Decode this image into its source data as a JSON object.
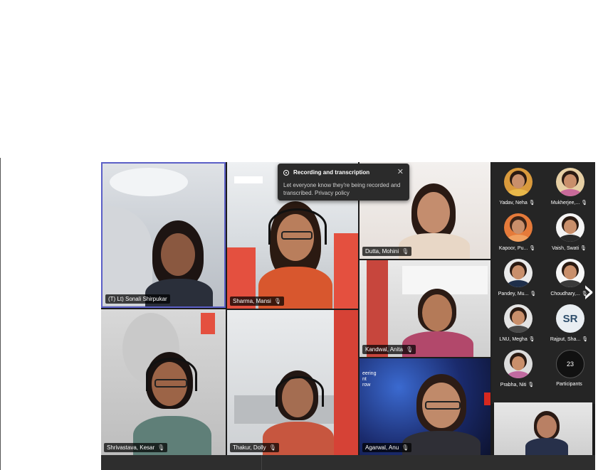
{
  "toast": {
    "title": "Recording and transcription",
    "body": "Let everyone know they're being recorded and transcribed. Privacy policy",
    "close_icon": "close-icon"
  },
  "grid": [
    {
      "name": "(T) Lt) Sonali Shirpukar"
    },
    {
      "name": "Sharma, Mansi"
    },
    {
      "name": "Dutta, Mohini"
    },
    {
      "name": "Kandwal, Anita"
    },
    {
      "name": "Shrivastava, Kesar"
    },
    {
      "name": "Thakur, Dolly"
    },
    {
      "name": "Agarwal, Anu"
    }
  ],
  "screen_text": "eering\nnt\nrow",
  "panel": {
    "participants": [
      {
        "name": "Yadav, Neha"
      },
      {
        "name": "Mukherjee,..."
      },
      {
        "name": "Kapoor, Pu..."
      },
      {
        "name": "Vaish, Swati"
      },
      {
        "name": "Pandey, Mu..."
      },
      {
        "name": "Choudhary,..."
      },
      {
        "name": "LNU, Megha"
      },
      {
        "name": "Rajput, Sha..."
      },
      {
        "name": "Prabha, Niti"
      }
    ],
    "sr_initials": "SR",
    "count": "23",
    "count_label": "Participants"
  },
  "icons": {
    "mic": "mic-icon",
    "next": "chevron-right-icon"
  },
  "colors": {
    "panel": "#252525",
    "stage": "#1c1c1c",
    "active_border": "#5b5fc7"
  }
}
